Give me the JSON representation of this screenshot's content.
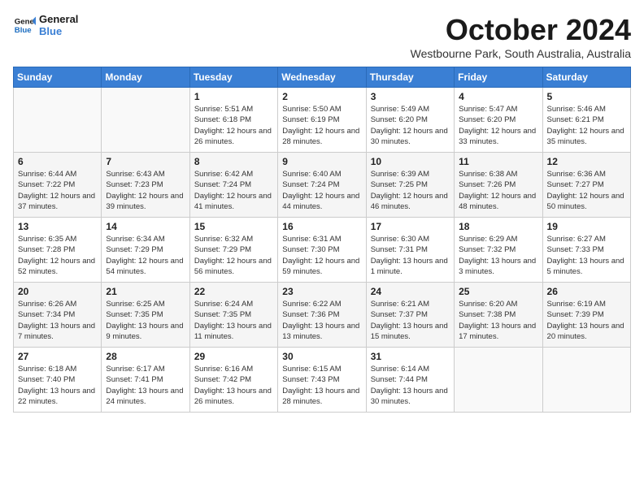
{
  "logo": {
    "line1": "General",
    "line2": "Blue"
  },
  "title": "October 2024",
  "subtitle": "Westbourne Park, South Australia, Australia",
  "days_of_week": [
    "Sunday",
    "Monday",
    "Tuesday",
    "Wednesday",
    "Thursday",
    "Friday",
    "Saturday"
  ],
  "weeks": [
    [
      {
        "day": "",
        "info": ""
      },
      {
        "day": "",
        "info": ""
      },
      {
        "day": "1",
        "info": "Sunrise: 5:51 AM\nSunset: 6:18 PM\nDaylight: 12 hours and 26 minutes."
      },
      {
        "day": "2",
        "info": "Sunrise: 5:50 AM\nSunset: 6:19 PM\nDaylight: 12 hours and 28 minutes."
      },
      {
        "day": "3",
        "info": "Sunrise: 5:49 AM\nSunset: 6:20 PM\nDaylight: 12 hours and 30 minutes."
      },
      {
        "day": "4",
        "info": "Sunrise: 5:47 AM\nSunset: 6:20 PM\nDaylight: 12 hours and 33 minutes."
      },
      {
        "day": "5",
        "info": "Sunrise: 5:46 AM\nSunset: 6:21 PM\nDaylight: 12 hours and 35 minutes."
      }
    ],
    [
      {
        "day": "6",
        "info": "Sunrise: 6:44 AM\nSunset: 7:22 PM\nDaylight: 12 hours and 37 minutes."
      },
      {
        "day": "7",
        "info": "Sunrise: 6:43 AM\nSunset: 7:23 PM\nDaylight: 12 hours and 39 minutes."
      },
      {
        "day": "8",
        "info": "Sunrise: 6:42 AM\nSunset: 7:24 PM\nDaylight: 12 hours and 41 minutes."
      },
      {
        "day": "9",
        "info": "Sunrise: 6:40 AM\nSunset: 7:24 PM\nDaylight: 12 hours and 44 minutes."
      },
      {
        "day": "10",
        "info": "Sunrise: 6:39 AM\nSunset: 7:25 PM\nDaylight: 12 hours and 46 minutes."
      },
      {
        "day": "11",
        "info": "Sunrise: 6:38 AM\nSunset: 7:26 PM\nDaylight: 12 hours and 48 minutes."
      },
      {
        "day": "12",
        "info": "Sunrise: 6:36 AM\nSunset: 7:27 PM\nDaylight: 12 hours and 50 minutes."
      }
    ],
    [
      {
        "day": "13",
        "info": "Sunrise: 6:35 AM\nSunset: 7:28 PM\nDaylight: 12 hours and 52 minutes."
      },
      {
        "day": "14",
        "info": "Sunrise: 6:34 AM\nSunset: 7:29 PM\nDaylight: 12 hours and 54 minutes."
      },
      {
        "day": "15",
        "info": "Sunrise: 6:32 AM\nSunset: 7:29 PM\nDaylight: 12 hours and 56 minutes."
      },
      {
        "day": "16",
        "info": "Sunrise: 6:31 AM\nSunset: 7:30 PM\nDaylight: 12 hours and 59 minutes."
      },
      {
        "day": "17",
        "info": "Sunrise: 6:30 AM\nSunset: 7:31 PM\nDaylight: 13 hours and 1 minute."
      },
      {
        "day": "18",
        "info": "Sunrise: 6:29 AM\nSunset: 7:32 PM\nDaylight: 13 hours and 3 minutes."
      },
      {
        "day": "19",
        "info": "Sunrise: 6:27 AM\nSunset: 7:33 PM\nDaylight: 13 hours and 5 minutes."
      }
    ],
    [
      {
        "day": "20",
        "info": "Sunrise: 6:26 AM\nSunset: 7:34 PM\nDaylight: 13 hours and 7 minutes."
      },
      {
        "day": "21",
        "info": "Sunrise: 6:25 AM\nSunset: 7:35 PM\nDaylight: 13 hours and 9 minutes."
      },
      {
        "day": "22",
        "info": "Sunrise: 6:24 AM\nSunset: 7:35 PM\nDaylight: 13 hours and 11 minutes."
      },
      {
        "day": "23",
        "info": "Sunrise: 6:22 AM\nSunset: 7:36 PM\nDaylight: 13 hours and 13 minutes."
      },
      {
        "day": "24",
        "info": "Sunrise: 6:21 AM\nSunset: 7:37 PM\nDaylight: 13 hours and 15 minutes."
      },
      {
        "day": "25",
        "info": "Sunrise: 6:20 AM\nSunset: 7:38 PM\nDaylight: 13 hours and 17 minutes."
      },
      {
        "day": "26",
        "info": "Sunrise: 6:19 AM\nSunset: 7:39 PM\nDaylight: 13 hours and 20 minutes."
      }
    ],
    [
      {
        "day": "27",
        "info": "Sunrise: 6:18 AM\nSunset: 7:40 PM\nDaylight: 13 hours and 22 minutes."
      },
      {
        "day": "28",
        "info": "Sunrise: 6:17 AM\nSunset: 7:41 PM\nDaylight: 13 hours and 24 minutes."
      },
      {
        "day": "29",
        "info": "Sunrise: 6:16 AM\nSunset: 7:42 PM\nDaylight: 13 hours and 26 minutes."
      },
      {
        "day": "30",
        "info": "Sunrise: 6:15 AM\nSunset: 7:43 PM\nDaylight: 13 hours and 28 minutes."
      },
      {
        "day": "31",
        "info": "Sunrise: 6:14 AM\nSunset: 7:44 PM\nDaylight: 13 hours and 30 minutes."
      },
      {
        "day": "",
        "info": ""
      },
      {
        "day": "",
        "info": ""
      }
    ]
  ]
}
